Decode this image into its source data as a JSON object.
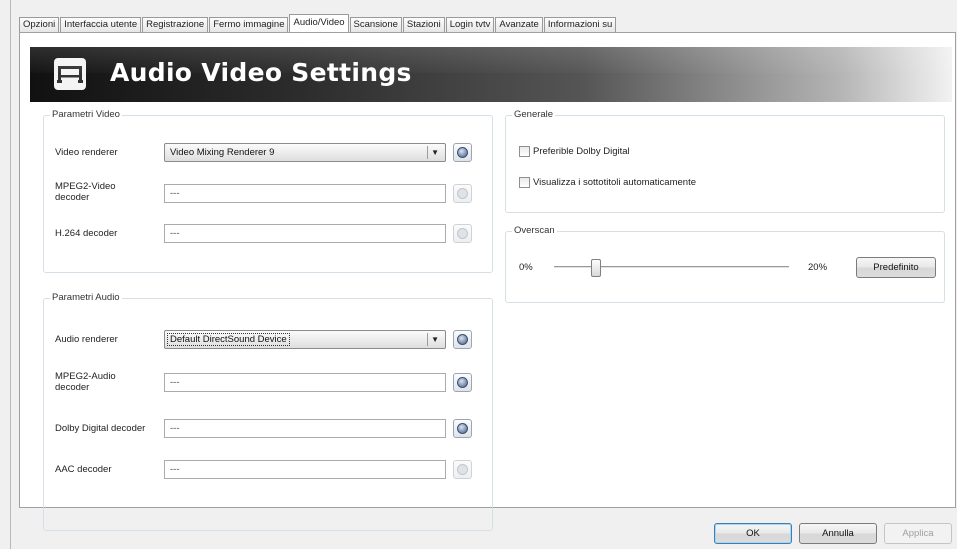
{
  "tabs": [
    {
      "label": "Opzioni"
    },
    {
      "label": "Interfaccia utente"
    },
    {
      "label": "Registrazione"
    },
    {
      "label": "Fermo immagine"
    },
    {
      "label": "Audio/Video",
      "active": true
    },
    {
      "label": "Scansione"
    },
    {
      "label": "Stazioni"
    },
    {
      "label": "Login tvtv"
    },
    {
      "label": "Avanzate"
    },
    {
      "label": "Informazioni su"
    }
  ],
  "banner": {
    "title": "Audio Video Settings",
    "icon": "video-device-icon"
  },
  "video_group": {
    "title": "Parametri Video",
    "renderer_label": "Video renderer",
    "renderer_value": "Video Mixing Renderer 9",
    "mpeg2_label_1": "MPEG2-Video",
    "mpeg2_label_2": "decoder",
    "mpeg2_value": "---",
    "h264_label": "H.264 decoder",
    "h264_value": "---"
  },
  "audio_group": {
    "title": "Parametri Audio",
    "renderer_label": "Audio renderer",
    "renderer_value": "Default DirectSound Device",
    "mpeg2_label_1": "MPEG2-Audio",
    "mpeg2_label_2": "decoder",
    "mpeg2_value": "---",
    "dolby_label": "Dolby Digital decoder",
    "dolby_value": "---",
    "aac_label": "AAC decoder",
    "aac_value": "---"
  },
  "general_group": {
    "title": "Generale",
    "dolby_pref_label": "Preferible Dolby Digital",
    "dolby_pref_checked": false,
    "subtitles_label": "Visualizza i sottotitoli automaticamente",
    "subtitles_checked": false
  },
  "overscan_group": {
    "title": "Overscan",
    "min_label": "0%",
    "max_label": "20%",
    "value_fraction": 0.05,
    "default_button": "Predefinito"
  },
  "footer": {
    "ok_label": "OK",
    "cancel_label": "Annulla",
    "apply_label": "Applica"
  }
}
